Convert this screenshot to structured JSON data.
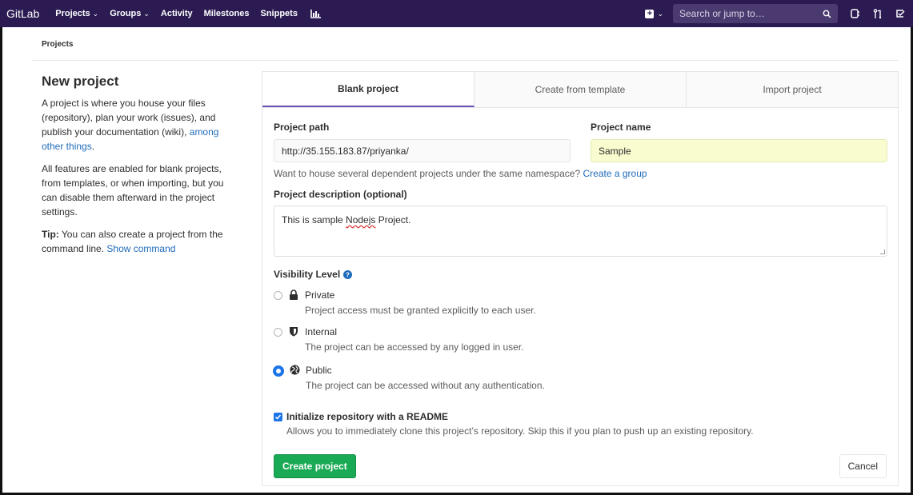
{
  "navbar": {
    "brand": "GitLab",
    "items": [
      {
        "label": "Projects",
        "dropdown": true
      },
      {
        "label": "Groups",
        "dropdown": true
      },
      {
        "label": "Activity",
        "dropdown": false
      },
      {
        "label": "Milestones",
        "dropdown": false
      },
      {
        "label": "Snippets",
        "dropdown": false
      }
    ],
    "chart_icon": "chart-icon",
    "new_icon": "plus-square-icon",
    "search_placeholder": "Search or jump to…",
    "search_icon": "search-icon",
    "right_icons": [
      "issues-icon",
      "merge-request-icon",
      "todo-icon"
    ]
  },
  "breadcrumb": "Projects",
  "intro": {
    "title": "New project",
    "p1": "A project is where you house your files (repository), plan your work (issues), and publish your documentation (wiki),",
    "p1_link": "among other things",
    "p1_end": ".",
    "p2": "All features are enabled for blank projects, from templates, or when importing, but you can disable them afterward in the project settings.",
    "tip_label": "Tip:",
    "tip_text": " You can also create a project from the command line.",
    "tip_link": "Show command"
  },
  "tabs": [
    {
      "label": "Blank project",
      "active": true
    },
    {
      "label": "Create from template",
      "active": false
    },
    {
      "label": "Import project",
      "active": false
    }
  ],
  "form": {
    "path_label": "Project path",
    "path_value": "http://35.155.183.87/priyanka/",
    "name_label": "Project name",
    "name_value": "Sample",
    "namespace_help": "Want to house several dependent projects under the same namespace?",
    "namespace_link": "Create a group",
    "desc_label": "Project description (optional)",
    "desc_value_pre": "This is sample ",
    "desc_value_misspelled": "Nodejs",
    "desc_value_post": " Project.",
    "visibility_label": "Visibility Level",
    "visibility_help_icon": "question-circle-icon",
    "visibility": [
      {
        "title": "Private",
        "desc": "Project access must be granted explicitly to each user.",
        "icon": "lock-icon",
        "selected": false
      },
      {
        "title": "Internal",
        "desc": "The project can be accessed by any logged in user.",
        "icon": "shield-icon",
        "selected": false
      },
      {
        "title": "Public",
        "desc": "The project can be accessed without any authentication.",
        "icon": "globe-icon",
        "selected": true
      }
    ],
    "readme_label": "Initialize repository with a README",
    "readme_checked": true,
    "readme_desc": "Allows you to immediately clone this project’s repository. Skip this if you plan to push up an existing repository.",
    "create_label": "Create project",
    "cancel_label": "Cancel"
  },
  "colors": {
    "navbar": "#2b1b52",
    "accent": "#6b4fbb",
    "link": "#1f6bbb",
    "create_button": "#1aaa55",
    "name_input_bg": "#f9fcce"
  }
}
